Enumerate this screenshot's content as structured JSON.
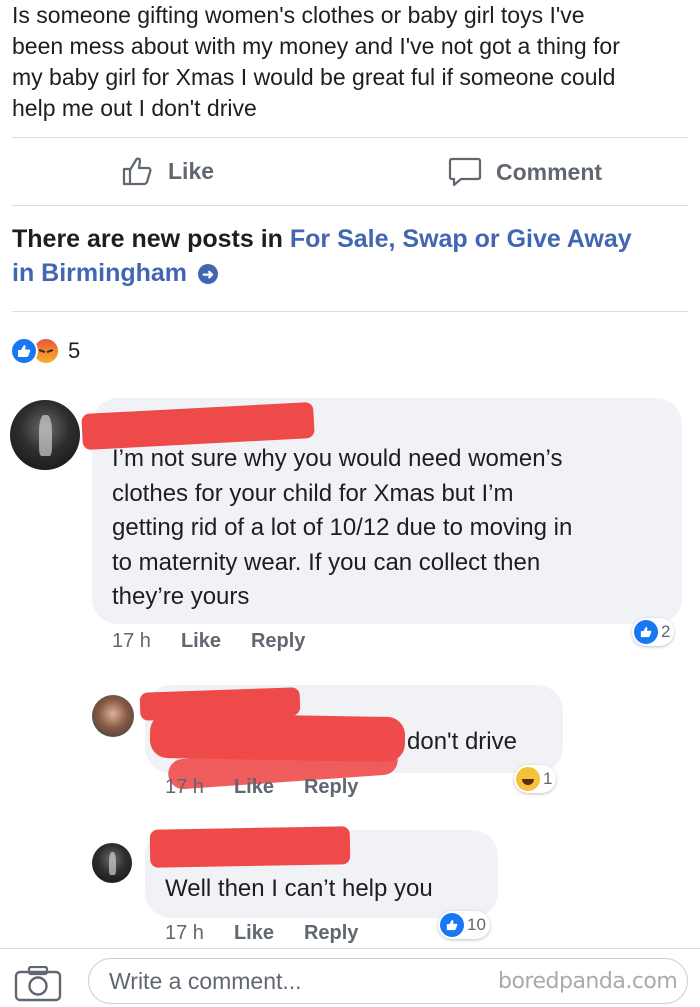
{
  "post": {
    "text_lines": [
      "Is someone gifting women's clothes or baby girl toys I've",
      "been mess about with my money and I've not got a thing for",
      "my baby girl for Xmas I would be great ful if someone could",
      "help me out I don't drive"
    ]
  },
  "actions": {
    "like_label": "Like",
    "comment_label": "Comment"
  },
  "new_posts": {
    "prefix": "There are new posts in ",
    "group_line1": "For Sale, Swap or Give Away",
    "group_line2": "in Birmingham"
  },
  "reactions": {
    "icons": [
      "like-icon",
      "angry-icon"
    ],
    "count": "5"
  },
  "comments": [
    {
      "text_lines": [
        "I’m not sure why you would need women’s",
        "clothes for your child for Xmas but I’m",
        "getting rid of a lot of 10/12 due to moving in",
        "to maternity wear. If you can collect then",
        "they’re yours"
      ],
      "time": "17 h",
      "like_label": "Like",
      "reply_label": "Reply",
      "reaction_icon": "like-icon",
      "reaction_count": "2"
    },
    {
      "visible_text": "don't drive",
      "time": "17 h",
      "like_label": "Like",
      "reply_label": "Reply",
      "reaction_icon": "haha-icon",
      "reaction_count": "1"
    },
    {
      "text": "Well then I can’t help you",
      "time": "17 h",
      "like_label": "Like",
      "reply_label": "Reply",
      "reaction_icon": "like-icon",
      "reaction_count": "10"
    }
  ],
  "composer": {
    "placeholder": "Write a comment..."
  },
  "watermark": "boredpanda.com",
  "colors": {
    "link_blue": "#4267b2",
    "like_blue": "#1877f2",
    "redaction_red": "#ef4a4a",
    "bubble_gray": "#f0f2f5"
  }
}
